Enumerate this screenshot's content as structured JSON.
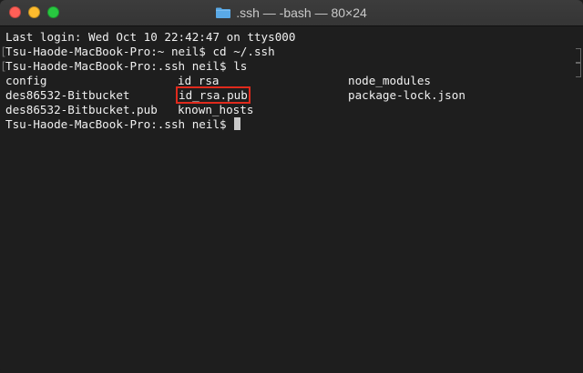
{
  "window": {
    "title": ".ssh — -bash — 80×24",
    "folder_icon": "folder-icon"
  },
  "terminal": {
    "last_login": "Last login: Wed Oct 10 22:42:47 on ttys000",
    "cmd1": "Tsu-Haode-MacBook-Pro:~ neil$ cd ~/.ssh",
    "cmd2": "Tsu-Haode-MacBook-Pro:.ssh neil$ ls",
    "listing": [
      [
        "config",
        "id_rsa",
        "node_modules"
      ],
      [
        "des86532-Bitbucket",
        "id_rsa.pub",
        "package-lock.json"
      ],
      [
        "des86532-Bitbucket.pub",
        "known_hosts",
        ""
      ]
    ],
    "prompt": "Tsu-Haode-MacBook-Pro:.ssh neil$ ",
    "highlight_color": "#e02a1c"
  }
}
